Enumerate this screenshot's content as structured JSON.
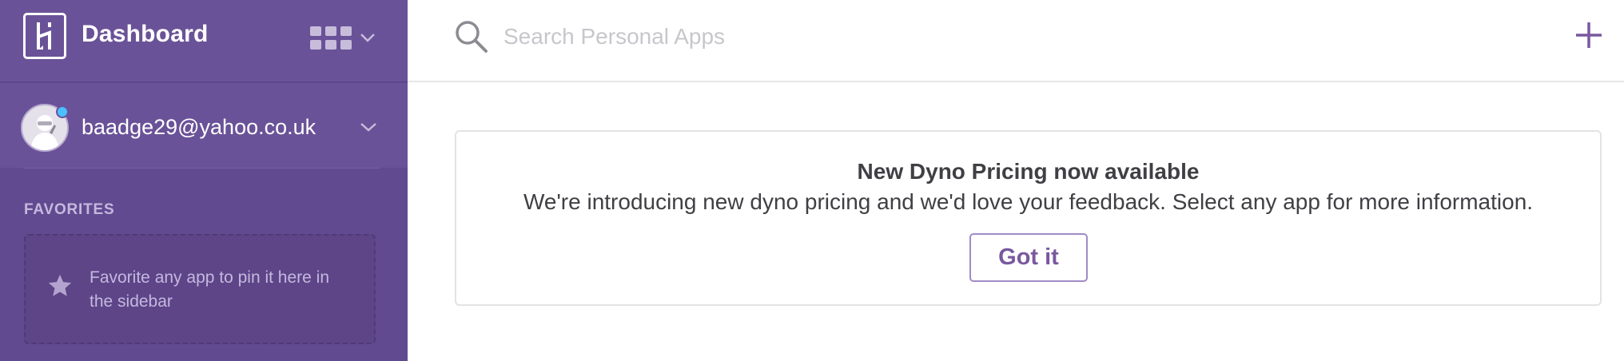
{
  "colors": {
    "sidebar_bg": "#624a90",
    "accent": "#79589f",
    "notification_dot": "#49c0ff"
  },
  "sidebar": {
    "logo_icon": "heroku-logo-icon",
    "title": "Dashboard",
    "apps_switcher_icon": "grid-icon",
    "account": {
      "email": "baadge29@yahoo.co.uk",
      "avatar_icon": "avatar-icon",
      "dropdown_icon": "chevron-down-icon"
    },
    "favorites": {
      "label": "FAVORITES",
      "empty_icon": "star-icon",
      "empty_text": "Favorite any app to pin it here in the sidebar"
    }
  },
  "topbar": {
    "search": {
      "icon": "search-icon",
      "placeholder": "Search Personal Apps",
      "value": ""
    },
    "add_icon": "plus-icon"
  },
  "banner": {
    "title": "New Dyno Pricing now available",
    "body": "We're introducing new dyno pricing and we'd love your feedback. Select any app for more information.",
    "button_label": "Got it"
  }
}
